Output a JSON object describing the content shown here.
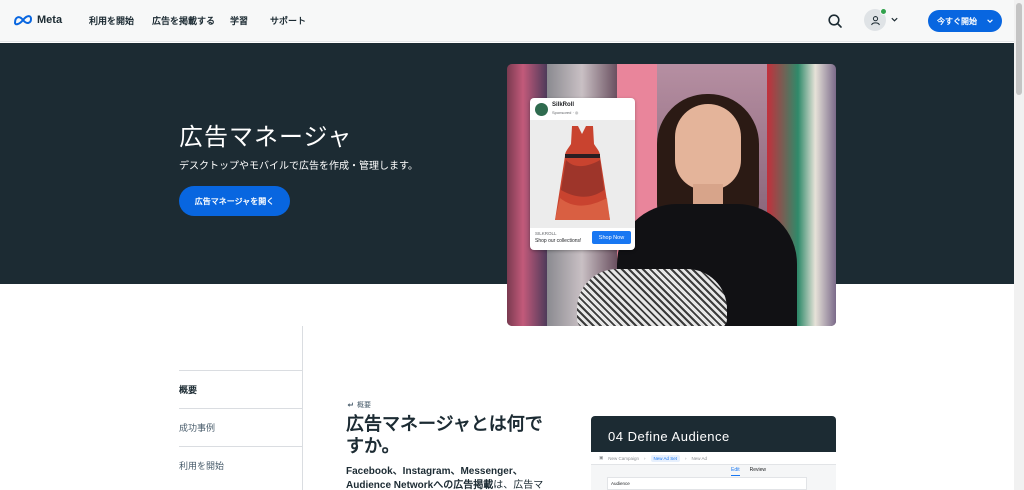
{
  "nav": {
    "logo_text": "Meta",
    "links": [
      "利用を開始",
      "広告を掲載する",
      "学習",
      "サポート"
    ],
    "cta_label": "今すぐ開始"
  },
  "hero": {
    "title": "広告マネージャ",
    "subtitle": "デスクトップやモバイルで広告を作成・管理します。",
    "button_label": "広告マネージャを開く"
  },
  "ad_preview": {
    "brand": "SilkRoll",
    "sponsored": "Sponsored · ◎",
    "advertiser": "SILKROLL",
    "tagline": "Shop our collections!",
    "shop_label": "Shop Now"
  },
  "side_nav": {
    "items": [
      "概要",
      "成功事例",
      "利用を開始"
    ]
  },
  "content": {
    "breadcrumb": "概要",
    "title": "広告マネージャとは何ですか。",
    "body_bold": "Facebook、Instagram、Messenger、Audience Networkへの広告掲載",
    "body_rest": "は、広告マ"
  },
  "step": {
    "title": "04 Define Audience",
    "crumb_campaign": "New Campaign",
    "crumb_adset": "New Ad Set",
    "crumb_ad": "New Ad",
    "tab_edit": "Edit",
    "tab_review": "Review",
    "form_label": "Audience"
  },
  "colors": {
    "brand_blue": "#0866e0",
    "hero_bg": "#1c2b33"
  }
}
